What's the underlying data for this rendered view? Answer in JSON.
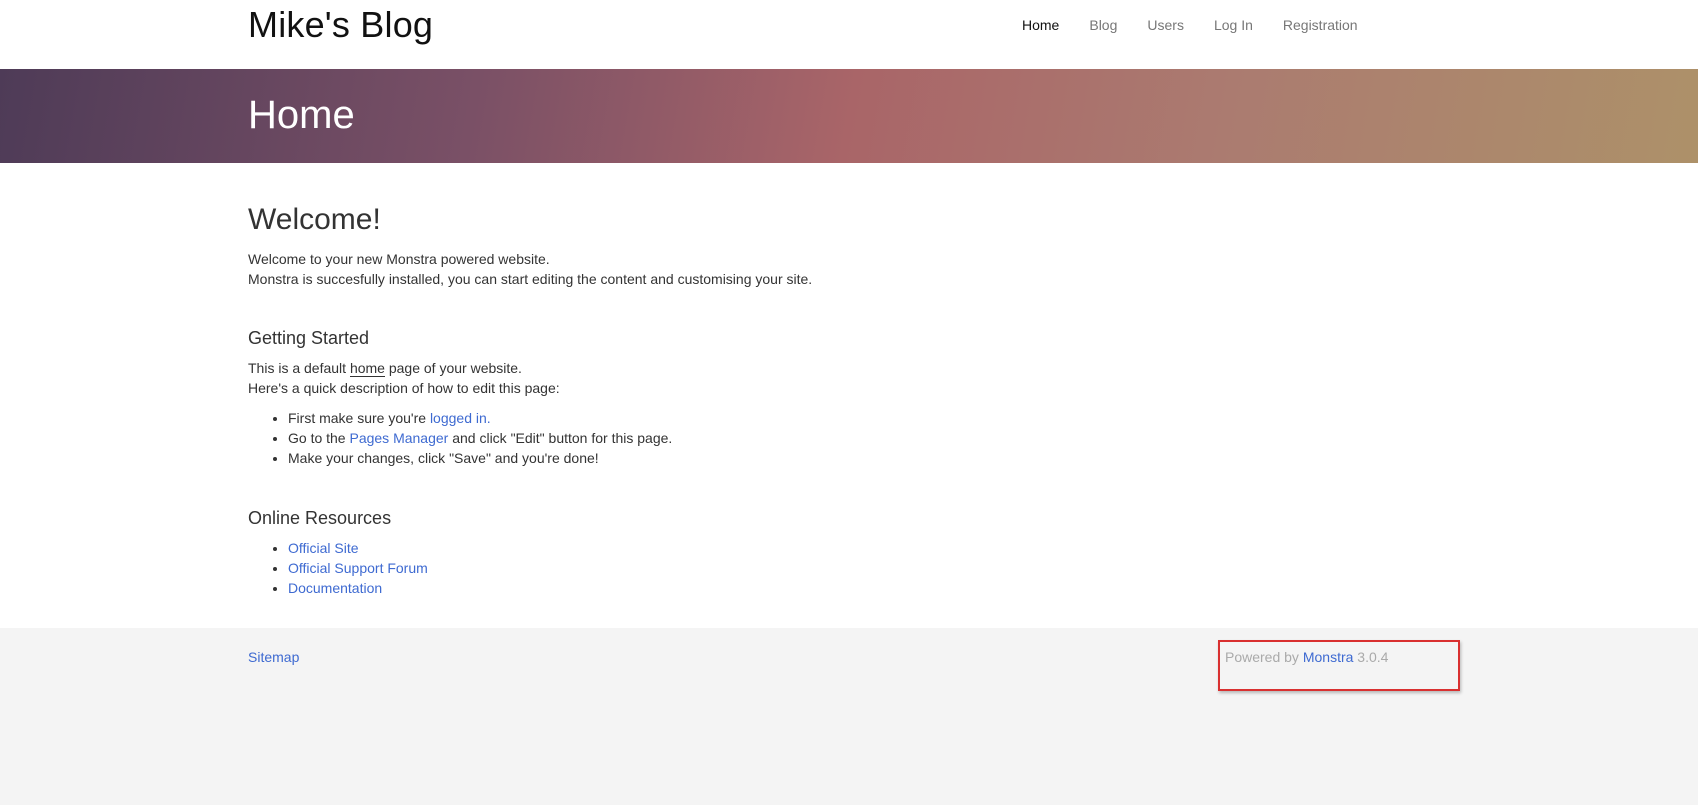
{
  "header": {
    "brand": "Mike's Blog",
    "nav": [
      "Home",
      "Blog",
      "Users",
      "Log In",
      "Registration"
    ]
  },
  "hero": {
    "title": "Home"
  },
  "main": {
    "welcome_title": "Welcome!",
    "welcome_line1": "Welcome to your new Monstra powered website.",
    "welcome_line2": "Monstra is succesfully installed, you can start editing the content and customising your site.",
    "getting_started_title": "Getting Started",
    "gs_line1_pre": "This is a default ",
    "gs_line1_link": "home",
    "gs_line1_post": " page of your website.",
    "gs_line2": "Here's a quick description of how to edit this page:",
    "steps": {
      "s1_pre": "First make sure you're ",
      "s1_link": "logged in.",
      "s2_pre": "Go to the ",
      "s2_link": "Pages Manager",
      "s2_post": " and click \"Edit\" button for this page.",
      "s3": "Make your changes, click \"Save\" and you're done!"
    },
    "resources_title": "Online Resources",
    "resources": [
      "Official Site",
      "Official Support Forum",
      "Documentation"
    ]
  },
  "footer": {
    "sitemap": "Sitemap",
    "powered_pre": "Powered by ",
    "powered_link": "Monstra",
    "powered_version": " 3.0.4"
  },
  "colors": {
    "link": "#3e6ad1",
    "highlight_border": "#d93030"
  }
}
